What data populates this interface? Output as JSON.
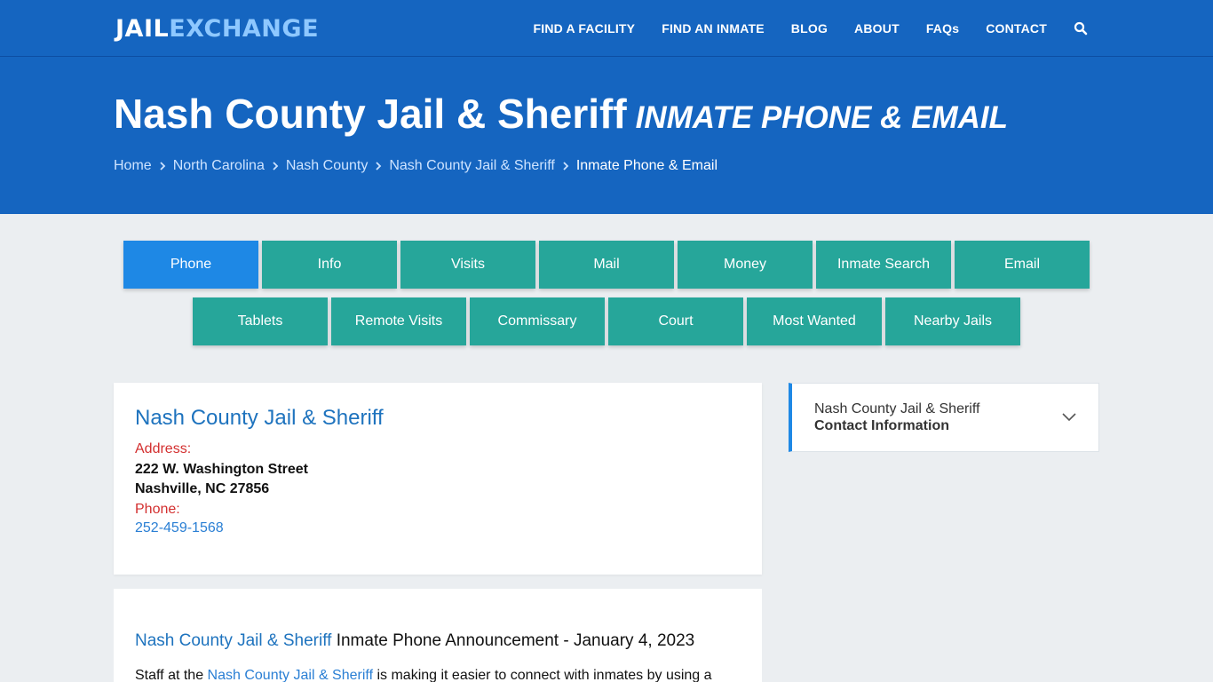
{
  "header": {
    "logo_part1": "JAIL",
    "logo_part2": "EXCHANGE",
    "nav": [
      "FIND A FACILITY",
      "FIND AN INMATE",
      "BLOG",
      "ABOUT",
      "FAQs",
      "CONTACT"
    ],
    "search_icon": "search-icon"
  },
  "hero": {
    "title": "Nash County Jail & Sheriff",
    "subtitle": "INMATE PHONE & EMAIL",
    "breadcrumbs": [
      "Home",
      "North Carolina",
      "Nash County",
      "Nash County Jail & Sheriff"
    ],
    "breadcrumb_current": "Inmate Phone & Email"
  },
  "tabs": {
    "row1": [
      "Phone",
      "Info",
      "Visits",
      "Mail",
      "Money",
      "Inmate Search",
      "Email"
    ],
    "row2": [
      "Tablets",
      "Remote Visits",
      "Commissary",
      "Court",
      "Most Wanted",
      "Nearby Jails"
    ],
    "active": "Phone"
  },
  "facility": {
    "name": "Nash County Jail & Sheriff",
    "address_label": "Address:",
    "address_line1": "222 W. Washington Street",
    "address_line2": "Nashville, NC 27856",
    "phone_label": "Phone:",
    "phone": "252-459-1568"
  },
  "announcement": {
    "heading_link": "Nash County Jail & Sheriff",
    "heading_rest": " Inmate Phone Announcement - January 4, 2023",
    "para_start": "Staff at the ",
    "para_link": "Nash County Jail & Sheriff",
    "para_rest": " is making it easier to connect with inmates by using a"
  },
  "sidebar": {
    "line1": "Nash County Jail & Sheriff",
    "line2": "Contact Information"
  },
  "colors": {
    "brand_blue": "#1565c0",
    "tab_teal": "#26a69a",
    "tab_active": "#1e88e5",
    "label_red": "#d32f2f",
    "link_blue": "#1e73be"
  }
}
